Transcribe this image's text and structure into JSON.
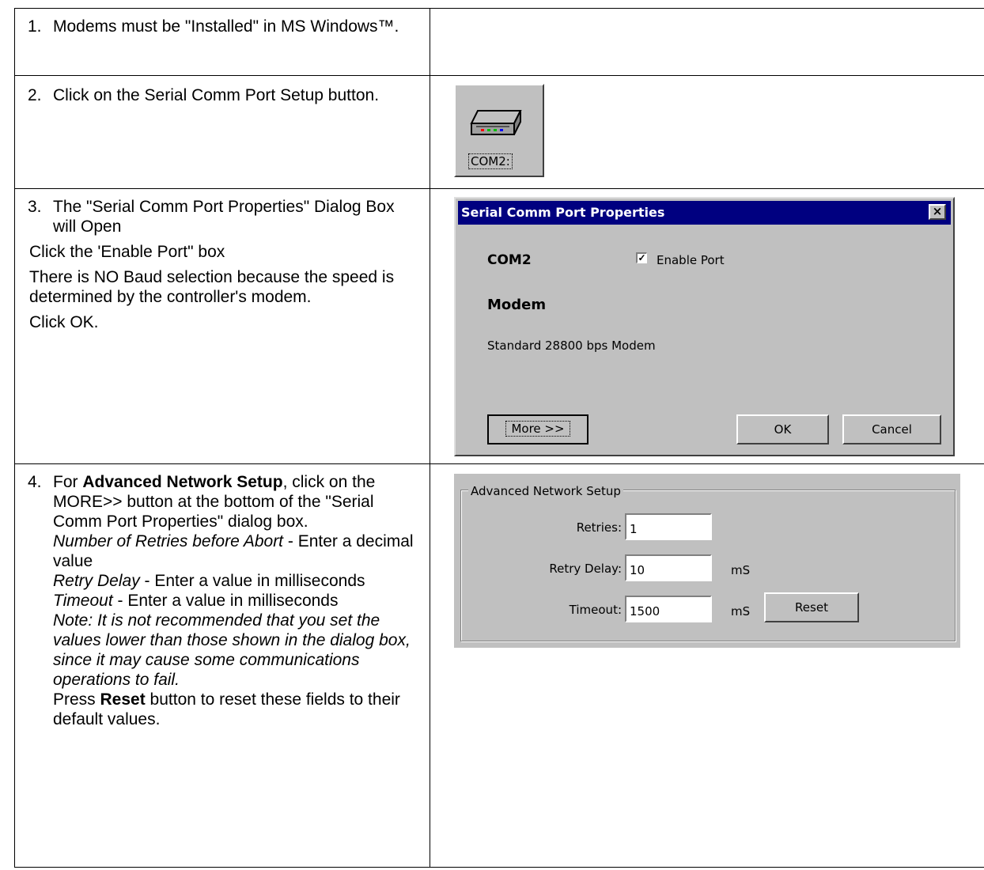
{
  "step1": {
    "num": "1.",
    "text": "Modems must be \"Installed\" in MS Windows™."
  },
  "step2": {
    "num": "2.",
    "text": "Click on the Serial Comm Port Setup button.",
    "button_label": "COM2:"
  },
  "step3": {
    "num": "3.",
    "intro": "The \"Serial Comm Port Properties\" Dialog Box will Open",
    "p1": "Click the 'Enable Port\" box",
    "p2": "There is NO Baud selection because the speed is determined by the controller's modem.",
    "p3": "Click OK."
  },
  "dialog": {
    "title": "Serial Comm Port Properties",
    "close": "×",
    "port": "COM2",
    "enable_label": "Enable Port",
    "enable_checked": "✓",
    "modem_heading": "Modem",
    "modem_name": "Standard 28800 bps Modem",
    "more_button": "More >>",
    "ok_button": "OK",
    "cancel_button": "Cancel"
  },
  "step4": {
    "num": "4.",
    "t1": "For ",
    "t1_bold": "Advanced Network Setup",
    "t1_rest": ", click on the MORE>> button at the bottom of the \"Serial Comm Port Properties\" dialog box.",
    "retries_italic": "Number of Retries before Abort",
    "retries_text": " - Enter a decimal value",
    "delay_italic": "Retry Delay",
    "delay_text": " - Enter a value in milliseconds",
    "timeout_italic": "Timeout",
    "timeout_text": " - Enter a value in milliseconds",
    "note": "Note: It is not recommended that you set the values lower than those shown in the dialog box, since it may cause some communications operations to fail.",
    "press": "Press ",
    "press_bold": "Reset",
    "press_rest": " button to reset these fields to their default values."
  },
  "advanced": {
    "group_title": "Advanced Network Setup",
    "retries_label": "Retries:",
    "retries_value": "1",
    "delay_label": "Retry Delay:",
    "delay_value": "10",
    "delay_unit": "mS",
    "timeout_label": "Timeout:",
    "timeout_value": "1500",
    "timeout_unit": "mS",
    "reset_button": "Reset"
  }
}
